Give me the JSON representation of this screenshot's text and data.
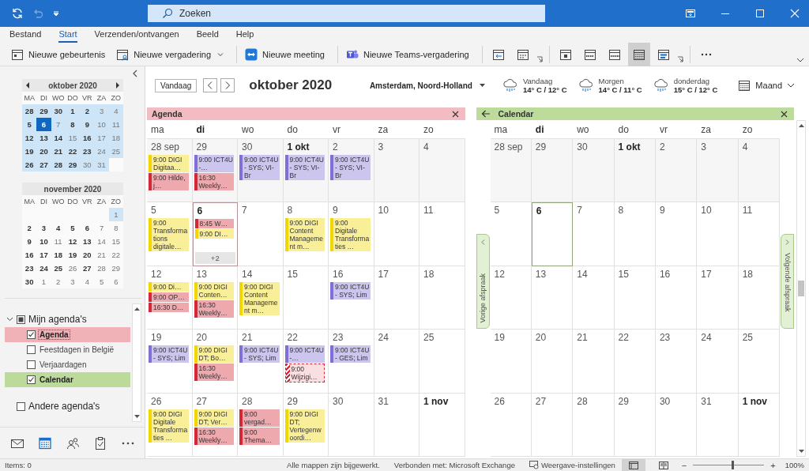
{
  "title_bar": {
    "search": {
      "placeholder": "Zoeken"
    }
  },
  "menu_tabs": [
    {
      "label": "Bestand",
      "selected": false
    },
    {
      "label": "Start",
      "selected": true
    },
    {
      "label": "Verzenden/ontvangen",
      "selected": false
    },
    {
      "label": "Beeld",
      "selected": false
    },
    {
      "label": "Help",
      "selected": false
    }
  ],
  "ribbon": {
    "buttons": [
      {
        "label": "Nieuwe gebeurtenis",
        "kind": "event",
        "has_menu": false
      },
      {
        "label": "Nieuwe vergadering",
        "kind": "meeting",
        "has_menu": true
      },
      {
        "label": "Nieuwe meeting",
        "kind": "teamviewer",
        "has_menu": false
      },
      {
        "label": "Nieuwe Teams-vergadering",
        "kind": "teams",
        "has_menu": false
      }
    ],
    "go_to": [
      {
        "kind": "today",
        "selected": false
      },
      {
        "kind": "next7",
        "selected": false
      }
    ],
    "arrange": [
      {
        "kind": "day",
        "selected": false
      },
      {
        "kind": "workweek",
        "selected": false
      },
      {
        "kind": "week",
        "selected": false
      },
      {
        "kind": "month",
        "selected": true
      },
      {
        "kind": "schedule",
        "selected": false
      }
    ]
  },
  "date_navigator": [
    {
      "title": "oktober 2020",
      "arrows": true,
      "weekdays": [
        "MA",
        "DI",
        "WO",
        "DO",
        "VR",
        "ZA",
        "ZO"
      ],
      "weeks": [
        [
          {
            "label": "28",
            "kind": "view_bold",
            "selected": false
          },
          {
            "label": "29",
            "kind": "view_bold",
            "selected": false
          },
          {
            "label": "30",
            "kind": "view_bold",
            "selected": false
          },
          {
            "label": "1",
            "kind": "view_bold",
            "selected": false
          },
          {
            "label": "2",
            "kind": "view_bold",
            "selected": false
          },
          {
            "label": "3",
            "kind": "view",
            "selected": false
          },
          {
            "label": "4",
            "kind": "view",
            "selected": false
          }
        ],
        [
          {
            "label": "5",
            "kind": "view_bold",
            "selected": false
          },
          {
            "label": "6",
            "kind": "view_bold",
            "selected": true
          },
          {
            "label": "7",
            "kind": "view",
            "selected": false
          },
          {
            "label": "8",
            "kind": "view_bold",
            "selected": false
          },
          {
            "label": "9",
            "kind": "view_bold",
            "selected": false
          },
          {
            "label": "10",
            "kind": "view",
            "selected": false
          },
          {
            "label": "11",
            "kind": "view",
            "selected": false
          }
        ],
        [
          {
            "label": "12",
            "kind": "view_bold",
            "selected": false
          },
          {
            "label": "13",
            "kind": "view_bold",
            "selected": false
          },
          {
            "label": "14",
            "kind": "view_bold",
            "selected": false
          },
          {
            "label": "15",
            "kind": "view",
            "selected": false
          },
          {
            "label": "16",
            "kind": "view_bold",
            "selected": false
          },
          {
            "label": "17",
            "kind": "view",
            "selected": false
          },
          {
            "label": "18",
            "kind": "view",
            "selected": false
          }
        ],
        [
          {
            "label": "19",
            "kind": "view_bold",
            "selected": false
          },
          {
            "label": "20",
            "kind": "view_bold",
            "selected": false
          },
          {
            "label": "21",
            "kind": "view_bold",
            "selected": false
          },
          {
            "label": "22",
            "kind": "view_bold",
            "selected": false
          },
          {
            "label": "23",
            "kind": "view_bold",
            "selected": false
          },
          {
            "label": "24",
            "kind": "view",
            "selected": false
          },
          {
            "label": "25",
            "kind": "view",
            "selected": false
          }
        ],
        [
          {
            "label": "26",
            "kind": "view_bold",
            "selected": false
          },
          {
            "label": "27",
            "kind": "view_bold",
            "selected": false
          },
          {
            "label": "28",
            "kind": "view_bold",
            "selected": false
          },
          {
            "label": "29",
            "kind": "view_bold",
            "selected": false
          },
          {
            "label": "30",
            "kind": "view",
            "selected": false
          },
          {
            "label": "31",
            "kind": "view",
            "selected": false
          }
        ]
      ]
    },
    {
      "title": "november 2020",
      "arrows": false,
      "weekdays": [
        "MA",
        "DI",
        "WO",
        "DO",
        "VR",
        "ZA",
        "ZO"
      ],
      "weeks": [
        [
          {
            "label": "1",
            "kind": "view",
            "selected": false
          }
        ],
        [
          {
            "label": "2",
            "kind": "bold",
            "selected": false
          },
          {
            "label": "3",
            "kind": "bold",
            "selected": false
          },
          {
            "label": "4",
            "kind": "bold",
            "selected": false
          },
          {
            "label": "5",
            "kind": "bold",
            "selected": false
          },
          {
            "label": "6",
            "kind": "bold",
            "selected": false
          },
          {
            "label": "7",
            "kind": "plain",
            "selected": false
          },
          {
            "label": "8",
            "kind": "plain",
            "selected": false
          }
        ],
        [
          {
            "label": "9",
            "kind": "bold",
            "selected": false
          },
          {
            "label": "10",
            "kind": "bold",
            "selected": false
          },
          {
            "label": "11",
            "kind": "plain",
            "selected": false
          },
          {
            "label": "12",
            "kind": "bold",
            "selected": false
          },
          {
            "label": "13",
            "kind": "bold",
            "selected": false
          },
          {
            "label": "14",
            "kind": "plain",
            "selected": false
          },
          {
            "label": "15",
            "kind": "plain",
            "selected": false
          }
        ],
        [
          {
            "label": "16",
            "kind": "bold",
            "selected": false
          },
          {
            "label": "17",
            "kind": "bold",
            "selected": false
          },
          {
            "label": "18",
            "kind": "bold",
            "selected": false
          },
          {
            "label": "19",
            "kind": "bold",
            "selected": false
          },
          {
            "label": "20",
            "kind": "bold",
            "selected": false
          },
          {
            "label": "21",
            "kind": "plain",
            "selected": false
          },
          {
            "label": "22",
            "kind": "plain",
            "selected": false
          }
        ],
        [
          {
            "label": "23",
            "kind": "bold",
            "selected": false
          },
          {
            "label": "24",
            "kind": "bold",
            "selected": false
          },
          {
            "label": "25",
            "kind": "bold",
            "selected": false
          },
          {
            "label": "26",
            "kind": "plain",
            "selected": false
          },
          {
            "label": "27",
            "kind": "bold",
            "selected": false
          },
          {
            "label": "28",
            "kind": "plain",
            "selected": false
          },
          {
            "label": "29",
            "kind": "plain",
            "selected": false
          }
        ],
        [
          {
            "label": "30",
            "kind": "bold",
            "selected": false
          },
          {
            "label": "1",
            "kind": "plain",
            "selected": false
          },
          {
            "label": "2",
            "kind": "plain",
            "selected": false
          },
          {
            "label": "3",
            "kind": "plain",
            "selected": false
          },
          {
            "label": "4",
            "kind": "plain",
            "selected": false
          },
          {
            "label": "5",
            "kind": "plain",
            "selected": false
          },
          {
            "label": "6",
            "kind": "plain",
            "selected": false
          }
        ]
      ]
    }
  ],
  "calendar_groups": [
    {
      "label": "Mijn agenda's",
      "partial": true,
      "expanded": true,
      "items": [
        {
          "label": "Agenda",
          "checked": true,
          "selected": true,
          "color": "#f0b1b7"
        },
        {
          "label": "Feestdagen in België",
          "checked": false,
          "selected": false
        },
        {
          "label": "Verjaardagen",
          "checked": false,
          "selected": false
        },
        {
          "label": "Calendar",
          "checked": true,
          "selected": false,
          "color": "#bcdb9a"
        }
      ]
    },
    {
      "label": "Andere agenda's",
      "partial": false,
      "expanded": false
    }
  ],
  "nav": [
    {
      "kind": "mail",
      "selected": false
    },
    {
      "kind": "calendar",
      "selected": true
    },
    {
      "kind": "people",
      "selected": false
    },
    {
      "kind": "tasks",
      "selected": false
    },
    {
      "kind": "more",
      "selected": false
    }
  ],
  "toolbar": {
    "today": "Vandaag",
    "title": "oktober 2020",
    "location": "Amsterdam, Noord-Holland",
    "weather": [
      {
        "day": "Vandaag",
        "temp": "14° C / 12° C"
      },
      {
        "day": "Morgen",
        "temp": "14° C / 11° C"
      },
      {
        "day": "donderdag",
        "temp": "15° C / 12° C"
      }
    ],
    "view": "Maand"
  },
  "panes": [
    {
      "title": "Agenda",
      "color": "#f3bcc2",
      "back": false,
      "weekdays": [
        {
          "label": "ma",
          "today": false
        },
        {
          "label": "di",
          "today": true
        },
        {
          "label": "wo",
          "today": false
        },
        {
          "label": "do",
          "today": false
        },
        {
          "label": "vr",
          "today": false
        },
        {
          "label": "za",
          "today": false
        },
        {
          "label": "zo",
          "today": false
        }
      ],
      "weeks": [
        [
          {
            "label": "28 sep",
            "kind": "shaded",
            "events": [
              {
                "text": "9:00 DIGI Digitaa…",
                "kind": "busy",
                "color": "#f2d600"
              },
              {
                "text": "9:00 Hilde, j…",
                "kind": "busy",
                "color": "#d42838"
              }
            ]
          },
          {
            "label": "29",
            "kind": "shaded",
            "events": [
              {
                "text": "9:00 ICT4U -…",
                "kind": "busy",
                "color": "#7f70d8"
              },
              {
                "text": "16:30 Weekly…",
                "kind": "busy",
                "color": "#d42838"
              }
            ]
          },
          {
            "label": "30",
            "kind": "shaded",
            "events": [
              {
                "text": "9:00 ICT4U - SYS; VI-Br",
                "kind": "busy",
                "color": "#7f70d8"
              }
            ]
          },
          {
            "label": "1 okt",
            "kind": "shaded_bold",
            "events": [
              {
                "text": "9:00 ICT4U - SYS; VI-Br",
                "kind": "busy",
                "color": "#7f70d8"
              }
            ]
          },
          {
            "label": "2",
            "kind": "shaded",
            "events": [
              {
                "text": "9:00 ICT4U - SYS; VI-Br",
                "kind": "busy",
                "color": "#7f70d8"
              }
            ]
          },
          {
            "label": "3",
            "kind": "shaded"
          },
          {
            "label": "4",
            "kind": "shaded"
          }
        ],
        [
          {
            "label": "5",
            "kind": "plain",
            "events": [
              {
                "text": "9:00 Transformations digitale…",
                "kind": "busy",
                "color": "#f2d600"
              }
            ]
          },
          {
            "label": "6",
            "kind": "today",
            "events": [
              {
                "text": "8:45 W…",
                "kind": "busy",
                "color": "#d42838"
              },
              {
                "text": "9:00 DI…",
                "kind": "busy",
                "color": "#f2d600"
              }
            ],
            "more": "+2"
          },
          {
            "label": "7",
            "kind": "plain"
          },
          {
            "label": "8",
            "kind": "plain",
            "events": [
              {
                "text": "9:00 DIGI Content Management m…",
                "kind": "busy",
                "color": "#f2d600"
              }
            ]
          },
          {
            "label": "9",
            "kind": "plain",
            "events": [
              {
                "text": "9:00 Digitale Transformaties …",
                "kind": "busy",
                "color": "#f2d600"
              }
            ]
          },
          {
            "label": "10",
            "kind": "plain"
          },
          {
            "label": "11",
            "kind": "plain"
          }
        ],
        [
          {
            "label": "12",
            "kind": "plain",
            "events": [
              {
                "text": "9:00 Di…",
                "kind": "busy",
                "color": "#f2d600"
              },
              {
                "text": "9:00 OP…",
                "kind": "busy",
                "color": "#d42838"
              },
              {
                "text": "16:30 D…",
                "kind": "busy",
                "color": "#d42838"
              }
            ]
          },
          {
            "label": "13",
            "kind": "plain",
            "events": [
              {
                "text": "9:00 DIGI Conten…",
                "kind": "busy",
                "color": "#f2d600"
              },
              {
                "text": "16:30 Weekly…",
                "kind": "busy",
                "color": "#d42838"
              }
            ]
          },
          {
            "label": "14",
            "kind": "plain",
            "events": [
              {
                "text": "9:00 DIGI Content Management m…",
                "kind": "busy",
                "color": "#f2d600"
              }
            ]
          },
          {
            "label": "15",
            "kind": "plain"
          },
          {
            "label": "16",
            "kind": "plain",
            "events": [
              {
                "text": "9:00 ICT4U - SYS; Lim",
                "kind": "busy",
                "color": "#7f70d8"
              }
            ]
          },
          {
            "label": "17",
            "kind": "plain"
          },
          {
            "label": "18",
            "kind": "plain"
          }
        ],
        [
          {
            "label": "19",
            "kind": "plain",
            "events": [
              {
                "text": "9:00 ICT4U - SYS; Lim",
                "kind": "busy",
                "color": "#7f70d8"
              }
            ]
          },
          {
            "label": "20",
            "kind": "plain",
            "events": [
              {
                "text": "9:00 DIGI DT; Bo…",
                "kind": "busy",
                "color": "#f2d600"
              },
              {
                "text": "16:30 Weekly…",
                "kind": "busy",
                "color": "#d42838"
              }
            ]
          },
          {
            "label": "21",
            "kind": "plain",
            "events": [
              {
                "text": "9:00 ICT4U - SYS; Lim",
                "kind": "busy",
                "color": "#7f70d8"
              }
            ]
          },
          {
            "label": "22",
            "kind": "plain",
            "events": [
              {
                "text": "9:00 ICT4U -…",
                "kind": "busy",
                "color": "#7f70d8"
              },
              {
                "text": "9:00 Wijzigi…",
                "kind": "tentative",
                "color": "#d42838"
              }
            ]
          },
          {
            "label": "23",
            "kind": "plain",
            "events": [
              {
                "text": "9:00 ICT4U - GES; Lim",
                "kind": "busy",
                "color": "#7f70d8"
              }
            ]
          },
          {
            "label": "24",
            "kind": "plain"
          },
          {
            "label": "25",
            "kind": "plain"
          }
        ],
        [
          {
            "label": "26",
            "kind": "plain",
            "events": [
              {
                "text": "9:00 DIGI Digitale Transformaties …",
                "kind": "busy",
                "color": "#f2d600"
              }
            ]
          },
          {
            "label": "27",
            "kind": "plain",
            "events": [
              {
                "text": "9:00 DIGI DT; Ver…",
                "kind": "busy",
                "color": "#f2d600"
              },
              {
                "text": "16:30 Weekly…",
                "kind": "busy",
                "color": "#d42838"
              }
            ]
          },
          {
            "label": "28",
            "kind": "plain",
            "events": [
              {
                "text": "9:00 vergad…",
                "kind": "busy",
                "color": "#d42838"
              },
              {
                "text": "9:00 Thema…",
                "kind": "busy",
                "color": "#d42838"
              }
            ]
          },
          {
            "label": "29",
            "kind": "plain",
            "events": [
              {
                "text": "9:00 DIGI DT; Vertegenwoordi…",
                "kind": "busy",
                "color": "#f2d600"
              }
            ]
          },
          {
            "label": "30",
            "kind": "plain"
          },
          {
            "label": "31",
            "kind": "plain"
          },
          {
            "label": "1 nov",
            "kind": "bold"
          }
        ]
      ]
    },
    {
      "title": "Calendar",
      "color": "#bddc9b",
      "back": true,
      "weekdays": [
        {
          "label": "ma",
          "today": false
        },
        {
          "label": "di",
          "today": true
        },
        {
          "label": "wo",
          "today": false
        },
        {
          "label": "do",
          "today": false
        },
        {
          "label": "vr",
          "today": false
        },
        {
          "label": "za",
          "today": false
        },
        {
          "label": "zo",
          "today": false
        }
      ],
      "weeks": [
        [
          {
            "label": "28 sep",
            "kind": "shaded"
          },
          {
            "label": "29",
            "kind": "shaded"
          },
          {
            "label": "30",
            "kind": "shaded"
          },
          {
            "label": "1 okt",
            "kind": "shaded_bold"
          },
          {
            "label": "2",
            "kind": "shaded"
          },
          {
            "label": "3",
            "kind": "shaded"
          },
          {
            "label": "4",
            "kind": "shaded"
          }
        ],
        [
          {
            "label": "5",
            "kind": "plain"
          },
          {
            "label": "6",
            "kind": "today"
          },
          {
            "label": "7",
            "kind": "plain"
          },
          {
            "label": "8",
            "kind": "plain"
          },
          {
            "label": "9",
            "kind": "plain"
          },
          {
            "label": "10",
            "kind": "plain"
          },
          {
            "label": "11",
            "kind": "plain"
          }
        ],
        [
          {
            "label": "12",
            "kind": "plain"
          },
          {
            "label": "13",
            "kind": "plain"
          },
          {
            "label": "14",
            "kind": "plain"
          },
          {
            "label": "15",
            "kind": "plain"
          },
          {
            "label": "16",
            "kind": "plain"
          },
          {
            "label": "17",
            "kind": "plain"
          },
          {
            "label": "18",
            "kind": "plain"
          }
        ],
        [
          {
            "label": "19",
            "kind": "plain"
          },
          {
            "label": "20",
            "kind": "plain"
          },
          {
            "label": "21",
            "kind": "plain"
          },
          {
            "label": "22",
            "kind": "plain"
          },
          {
            "label": "23",
            "kind": "plain"
          },
          {
            "label": "24",
            "kind": "plain"
          },
          {
            "label": "25",
            "kind": "plain"
          }
        ],
        [
          {
            "label": "26",
            "kind": "plain"
          },
          {
            "label": "27",
            "kind": "plain"
          },
          {
            "label": "28",
            "kind": "plain"
          },
          {
            "label": "29",
            "kind": "plain"
          },
          {
            "label": "30",
            "kind": "plain"
          },
          {
            "label": "31",
            "kind": "plain"
          },
          {
            "label": "1 nov",
            "kind": "bold"
          }
        ]
      ]
    }
  ],
  "appointment_nav": {
    "previous": "Vorige afspraak",
    "next": "Volgende afspraak"
  },
  "status_bar": {
    "items": "Items: 0",
    "sync": "Alle mappen zijn bijgewerkt.",
    "connection": "Verbonden met: Microsoft Exchange",
    "display_settings": "Weergave-instellingen",
    "views": [
      {
        "kind": "normal",
        "selected": true
      },
      {
        "kind": "reading",
        "selected": false
      }
    ],
    "zoom_out": "−",
    "zoom_in": "+",
    "zoom": {
      "level": 0.55,
      "reading": "100%"
    }
  }
}
